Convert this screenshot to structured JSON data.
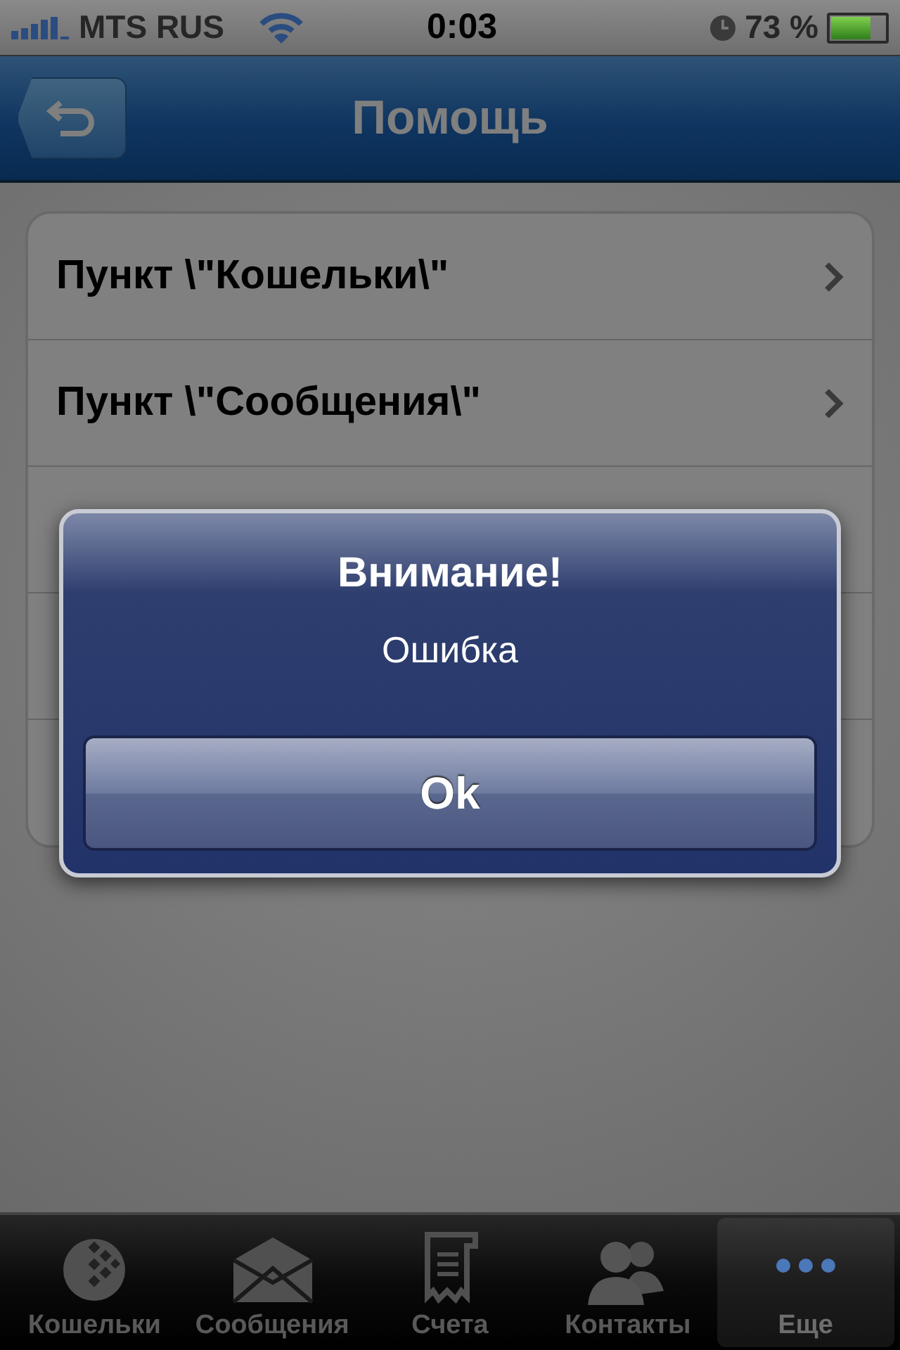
{
  "status_bar": {
    "carrier": "MTS RUS",
    "time": "0:03",
    "battery": "73 %",
    "level": 0.73
  },
  "nav_bar": {
    "title": "Помощь"
  },
  "menu": [
    {
      "label": "Пункт \\\"Кошельки\\\""
    },
    {
      "label": "Пункт \\\"Сообщения\\\""
    }
  ],
  "alert": {
    "title": "Внимание!",
    "message": "Ошибка",
    "button": "Ok"
  },
  "tab_bar": [
    {
      "label": "Кошельки",
      "kind": "wallet",
      "selected": false
    },
    {
      "label": "Сообщения",
      "kind": "envelope",
      "selected": false
    },
    {
      "label": "Счета",
      "kind": "scroll",
      "selected": false
    },
    {
      "label": "Контакты",
      "kind": "people",
      "selected": false
    },
    {
      "label": "Еще",
      "kind": "dots",
      "selected": true
    }
  ]
}
